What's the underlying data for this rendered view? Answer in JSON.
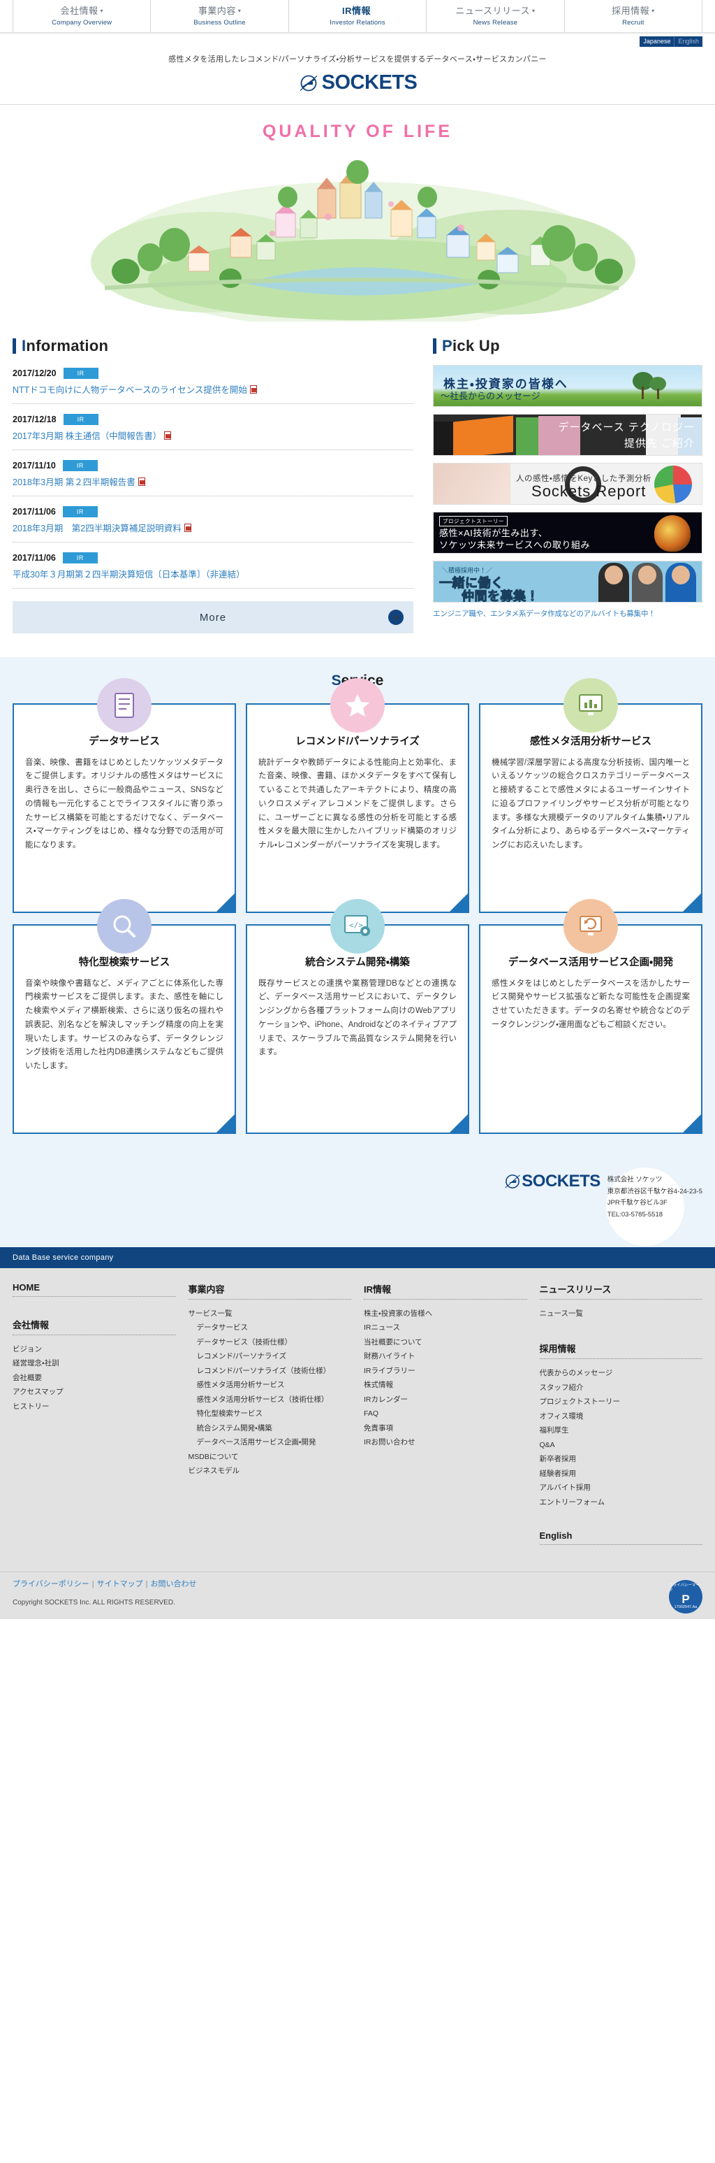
{
  "nav": {
    "items": [
      {
        "ja": "会社情報",
        "en": "Company Overview",
        "caret": "▾",
        "active": false
      },
      {
        "ja": "事業内容",
        "en": "Business Outline",
        "caret": "▾",
        "active": false
      },
      {
        "ja": "IR情報",
        "en": "Investor Relations",
        "caret": "",
        "active": true
      },
      {
        "ja": "ニュースリリース",
        "en": "News Release",
        "caret": "▾",
        "active": false
      },
      {
        "ja": "採用情報",
        "en": "Recruit",
        "caret": "▾",
        "active": false
      }
    ]
  },
  "lang": {
    "active": "Japanese",
    "inactive": "English"
  },
  "header": {
    "tagline": "感性メタを活用したレコメンド/パーソナライズ・分析サービスを提供するデータベース・サービスカンパニー",
    "logo_text": "SOCKETS"
  },
  "hero": {
    "title": "QUALITY OF LIFE"
  },
  "information": {
    "heading_cap": "I",
    "heading_rest": "nformation",
    "items": [
      {
        "date": "2017/12/20",
        "badge": "IR",
        "title": "NTTドコモ向けに人物データベースのライセンス提供を開始",
        "pdf": true
      },
      {
        "date": "2017/12/18",
        "badge": "IR",
        "title": "2017年3月期 株主通信（中間報告書）",
        "pdf": true
      },
      {
        "date": "2017/11/10",
        "badge": "IR",
        "title": "2018年3月期 第２四半期報告書",
        "pdf": true
      },
      {
        "date": "2017/11/06",
        "badge": "IR",
        "title": "2018年3月期　第2四半期決算補足説明資料",
        "pdf": true
      },
      {
        "date": "2017/11/06",
        "badge": "IR",
        "title": "平成30年３月期第２四半期決算短信〔日本基準〕（非連結）",
        "pdf": false
      }
    ],
    "more_label": "More",
    "more_arrow": "➜"
  },
  "pickup": {
    "heading_cap": "P",
    "heading_rest": "ick Up",
    "banners": [
      {
        "line1": "株主・投資家の皆様へ",
        "line2": "～社長からのメッセージ"
      },
      {
        "line1": "データベース テクノロジー",
        "line2": "提供先 ご紹介"
      },
      {
        "line1": "人の感性・感情をKeyとした予測分析",
        "line2": "Sockets Report"
      },
      {
        "tag": "プロジェクトストーリー",
        "line1": "感性×AI技術が生み出す、",
        "line2": "ソケッツ未来サービスへの取り組み"
      },
      {
        "line0": "＼積極採用中！／",
        "line1": "一緒に働く",
        "line2": "仲間を募集！"
      }
    ],
    "caption": "エンジニア職や、エンタメ系データ作成などのアルバイトも募集中！"
  },
  "service": {
    "heading_cap": "S",
    "heading_rest": "ervice",
    "cards": [
      {
        "icon": "document-icon",
        "icon_bg": "#ddd0ea",
        "title": "データサービス",
        "body": "音楽、映像、書籍をはじめとしたソケッツメタデータをご提供します。オリジナルの感性メタはサービスに奥行きを出し、さらに一般商品やニュース、SNSなどの情報も一元化することでライフスタイルに寄り添ったサービス構築を可能とするだけでなく、データベース・マーケティングをはじめ、様々な分野での活用が可能になります。"
      },
      {
        "icon": "star-icon",
        "icon_bg": "#f6c6d8",
        "title": "レコメンド/パーソナライズ",
        "body": "統計データや教師データによる性能向上と効率化、また音楽、映像、書籍、ほかメタデータをすべて保有していることで共通したアーキテクトにより、精度の高いクロスメディアレコメンドをご提供します。さらに、ユーザーごとに異なる感性の分析を可能とする感性メタを最大限に生かしたハイブリッド構築のオリジナル・レコメンダーがパーソナライズを実現します。"
      },
      {
        "icon": "chart-monitor-icon",
        "icon_bg": "#cfe3ae",
        "title": "感性メタ活用分析サービス",
        "body": "機械学習/深層学習による高度な分析技術、国内唯一といえるソケッツの総合クロスカテゴリーデータベースと接続することで感性メタによるユーザーインサイトに迫るプロファイリングやサービス分析が可能となります。多様な大規模データのリアルタイム集積・リアルタイム分析により、あらゆるデータベース・マーケティングにお応えいたします。"
      },
      {
        "icon": "magnifier-icon",
        "icon_bg": "#b9c5e8",
        "title": "特化型検索サービス",
        "body": "音楽や映像や書籍など、メディアごとに体系化した専門検索サービスをご提供します。また、感性を軸にした検索やメディア横断検索、さらに送り仮名の揺れや誤表記、別名などを解決しマッチング精度の向上を実現いたします。サービスのみならず、データクレンジング技術を活用した社内DB連携システムなどもご提供いたします。"
      },
      {
        "icon": "code-gear-icon",
        "icon_bg": "#a7dae3",
        "title": "統合システム開発・構築",
        "body": "既存サービスとの連携や業務管理DBなどとの連携など、データベース活用サービスにおいて、データクレンジングから各種プラットフォーム向けのWebアプリケーションや、iPhone、Androidなどのネイティブアプリまで、スケーラブルで高品質なシステム開発を行います。"
      },
      {
        "icon": "monitor-refresh-icon",
        "icon_bg": "#f3c3a0",
        "title": "データベース活用サービス企画・開発",
        "body": "感性メタをはじめとしたデータベースを活かしたサービス開発やサービス拡張など新たな可能性を企画提案させていただきます。データの名寄せや統合などのデータクレンジング・運用面などもご相談ください。"
      }
    ]
  },
  "corporate": {
    "logo_text": "SOCKETS",
    "name": "株式会社 ソケッツ",
    "address": "東京都渋谷区千駄ケ谷4-24-23-5",
    "building": "JPR千駄ケ谷ビル3F",
    "tel": "TEL:03-5785-5518"
  },
  "footer": {
    "bar_text": "Data Base service company",
    "columns": [
      {
        "head": "HOME",
        "links": [],
        "head2": "会社情報",
        "links2": [
          "ビジョン",
          "経営理念・社訓",
          "会社概要",
          "アクセスマップ",
          "ヒストリー"
        ]
      },
      {
        "head": "事業内容",
        "links": [
          {
            "label": "サービス一覧",
            "indent": false
          },
          {
            "label": "データサービス",
            "indent": true
          },
          {
            "label": "データサービス（技術仕様）",
            "indent": true
          },
          {
            "label": "レコメンド/パーソナライズ",
            "indent": true
          },
          {
            "label": "レコメンド/パーソナライズ（技術仕様）",
            "indent": true
          },
          {
            "label": "感性メタ活用分析サービス",
            "indent": true
          },
          {
            "label": "感性メタ活用分析サービス（技術仕様）",
            "indent": true
          },
          {
            "label": "特化型検索サービス",
            "indent": true
          },
          {
            "label": "統合システム開発・構築",
            "indent": true
          },
          {
            "label": "データベース活用サービス企画・開発",
            "indent": true
          },
          {
            "label": "MSDBについて",
            "indent": false
          },
          {
            "label": "ビジネスモデル",
            "indent": false
          }
        ]
      },
      {
        "head": "IR情報",
        "links": [
          {
            "label": "株主・投資家の皆様へ",
            "indent": false
          },
          {
            "label": "IRニュース",
            "indent": false
          },
          {
            "label": "当社概要について",
            "indent": false
          },
          {
            "label": "財務ハイライト",
            "indent": false
          },
          {
            "label": "IRライブラリー",
            "indent": false
          },
          {
            "label": "株式情報",
            "indent": false
          },
          {
            "label": "IRカレンダー",
            "indent": false
          },
          {
            "label": "FAQ",
            "indent": false
          },
          {
            "label": "免責事項",
            "indent": false
          },
          {
            "label": "IRお問い合わせ",
            "indent": false
          }
        ]
      },
      {
        "head": "ニュースリリース",
        "links": [
          {
            "label": "ニュース一覧",
            "indent": false
          }
        ],
        "head2": "採用情報",
        "links2": [
          "代表からのメッセージ",
          "スタッフ紹介",
          "プロジェクトストーリー",
          "オフィス環境",
          "福利厚生",
          "Q&A",
          "新卒者採用",
          "経験者採用",
          "アルバイト採用",
          "エントリーフォーム"
        ],
        "head3": "English"
      }
    ],
    "bottom_links": [
      "プライバシーポリシー",
      "サイトマップ",
      "お問い合わせ"
    ],
    "copyright": "Copyright SOCKETS Inc. ALL RIGHTS RESERVED.",
    "privacy_mark": {
      "top": "プライバシーマーク",
      "big": "P",
      "bottom": "17002547.Aa"
    }
  }
}
